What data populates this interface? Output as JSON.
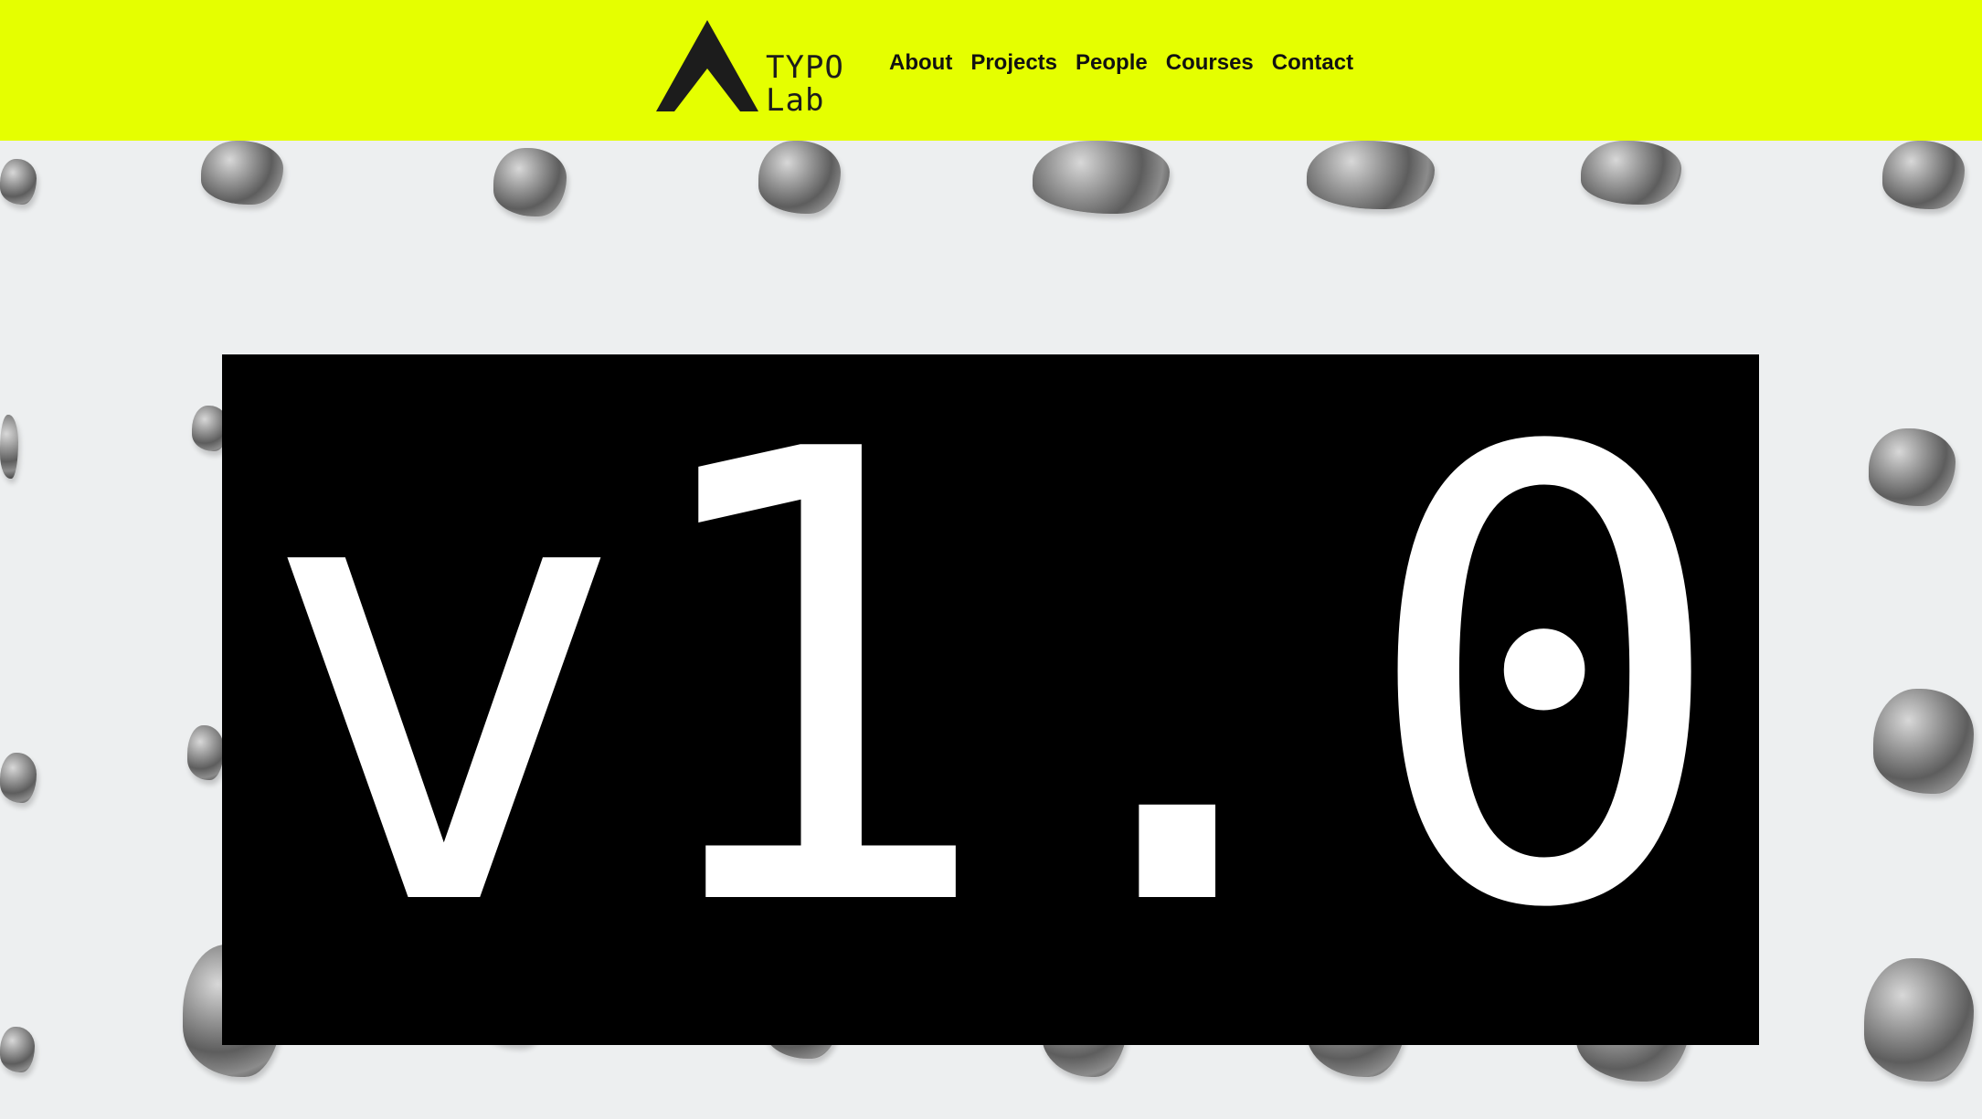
{
  "header": {
    "logo": {
      "line1": "TYPO",
      "line2": "Lab",
      "icon": "triangle-a-logo-icon"
    },
    "nav": [
      {
        "label": "About"
      },
      {
        "label": "Projects"
      },
      {
        "label": "People"
      },
      {
        "label": "Courses"
      },
      {
        "label": "Contact"
      }
    ],
    "background_color": "#e5ff00"
  },
  "hero": {
    "banner_text": "v1.0",
    "banner_background": "#000000",
    "banner_text_color": "#ffffff",
    "image_subject": "metal-nuggets-pattern"
  }
}
